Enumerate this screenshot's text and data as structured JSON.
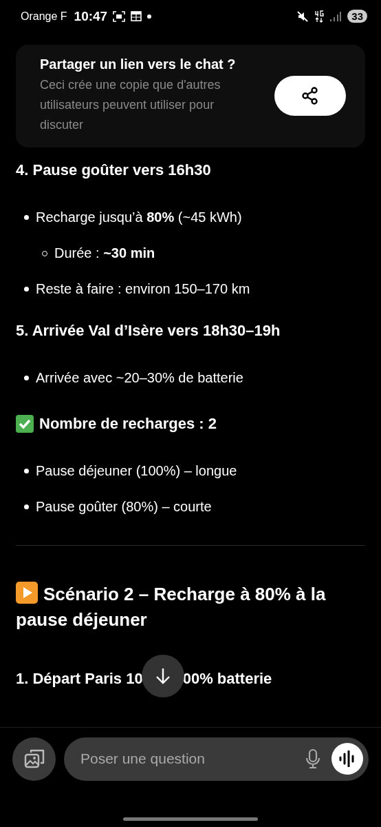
{
  "status_bar": {
    "carrier": "Orange F",
    "time": "10:47",
    "battery": "33"
  },
  "share_card": {
    "title": "Partager un lien vers le chat ?",
    "description": "Ceci crée une copie que d'autres utilisateurs peuvent utiliser pour discuter"
  },
  "content": [
    {
      "kind": "heading",
      "text": "4. Pause goûter vers 16h30"
    },
    {
      "kind": "bullet",
      "text": "Recharge jusqu’à **80%** (~45 kWh)"
    },
    {
      "kind": "subbullet",
      "text": "Durée : **~30 min**"
    },
    {
      "kind": "bullet",
      "text": "Reste à faire : environ 150–170 km"
    },
    {
      "kind": "heading",
      "text": "5. Arrivée Val d’Isère vers 18h30–19h"
    },
    {
      "kind": "bullet",
      "text": "Arrivée avec ~20–30% de batterie"
    },
    {
      "kind": "check_heading",
      "text": "Nombre de recharges : 2"
    },
    {
      "kind": "bullet",
      "text": "Pause déjeuner (100%) – longue"
    },
    {
      "kind": "bullet",
      "text": "Pause goûter (80%) – courte"
    },
    {
      "kind": "divider"
    },
    {
      "kind": "play_heading",
      "text": "Scénario 2 – Recharge à 80% à la pause déjeuner"
    },
    {
      "kind": "split_heading",
      "left": "1. Départ Paris 10",
      "right": "00% batterie"
    }
  ],
  "composer": {
    "placeholder": "Poser une question"
  }
}
